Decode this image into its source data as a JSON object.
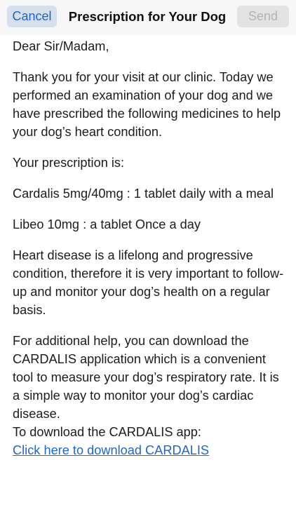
{
  "header": {
    "cancel_label": "Cancel",
    "title": "Prescription for Your Dog",
    "send_label": "Send"
  },
  "body": {
    "greeting": "Dear Sir/Madam,",
    "intro": "Thank you for your visit at our clinic. Today we performed an examination of your dog and we have prescribed the following medicines to help your dog’s heart condition.",
    "prescription_heading": "Your prescription is:",
    "medicine_1": "Cardalis 5mg/40mg : 1 tablet daily with a meal",
    "medicine_2": "Libeo 10mg : a tablet Once a day",
    "heart_disease_text": "Heart disease is a lifelong and progressive condition, therefore it is very important to follow-up and monitor your dog’s health on a regular basis.",
    "additional_help": "For additional help, you can download the CARDALIS application which is a convenient tool to measure your dog’s respiratory rate. It is a simple way to monitor your dog’s cardiac disease.",
    "download_prompt": "To download the CARDALIS app:",
    "download_link": "Click here to download CARDALIS"
  },
  "colors": {
    "accent": "#1f66cc",
    "cancel_bg": "#d6dfec",
    "send_disabled_bg": "#e3e3e3",
    "send_disabled_text": "#b2b2b2"
  }
}
